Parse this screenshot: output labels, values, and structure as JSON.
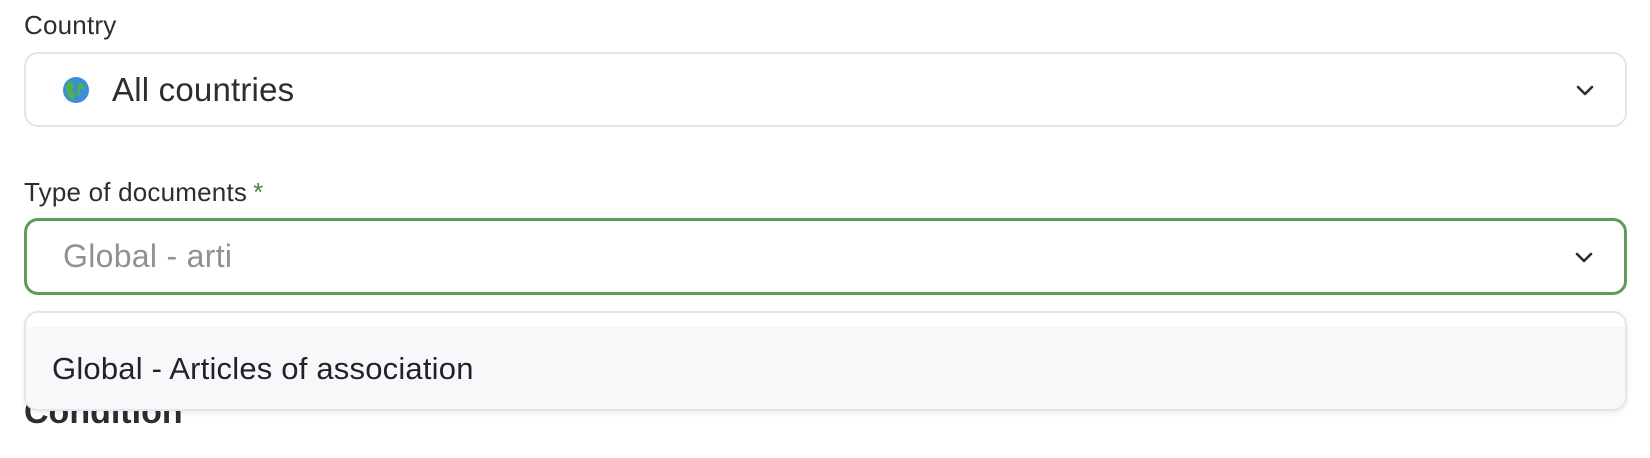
{
  "country": {
    "label": "Country",
    "value": "All countries",
    "icon": "globe-icon"
  },
  "document_type": {
    "label": "Type of documents",
    "required_marker": "*",
    "input_value": "Global - arti",
    "focus_color": "#5f9a5c"
  },
  "dropdown": {
    "options": [
      {
        "label": "Global - Articles of association"
      }
    ]
  },
  "section": {
    "heading": "Condition"
  }
}
